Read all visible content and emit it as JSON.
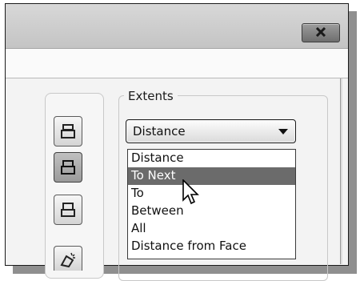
{
  "window": {
    "close_icon": "close-icon"
  },
  "extents": {
    "label": "Extents",
    "selected": "Distance",
    "options": [
      "Distance",
      "To Next",
      "To",
      "Between",
      "All",
      "Distance from Face"
    ],
    "highlighted_option": "To Next"
  },
  "icons": [
    "extrude-distance-icon",
    "extrude-to-next-icon",
    "extrude-to-icon",
    "taper-icon"
  ],
  "colors": {
    "highlight": "#6b6b6b",
    "frame": "#1a1a1a"
  }
}
